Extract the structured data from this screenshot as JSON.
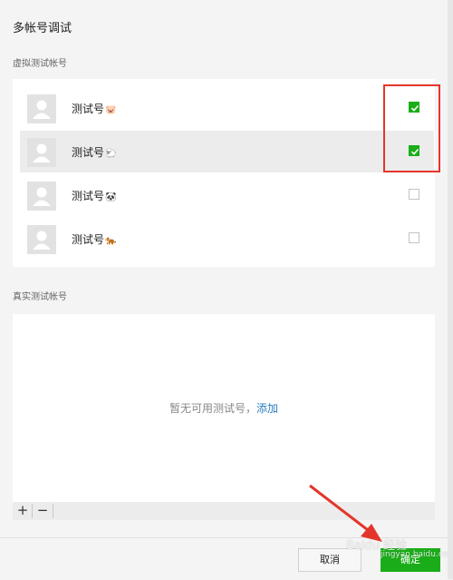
{
  "dialog": {
    "title": "多帐号调试"
  },
  "virtual_section": {
    "label": "虚拟测试帐号",
    "accounts": [
      {
        "name": "测试号",
        "emoji": "🐷",
        "checked": true
      },
      {
        "name": "测试号",
        "emoji": "🐑",
        "checked": true
      },
      {
        "name": "测试号",
        "emoji": "🐼",
        "checked": false
      },
      {
        "name": "测试号",
        "emoji": "🐅",
        "checked": false
      }
    ]
  },
  "real_section": {
    "label": "真实测试帐号",
    "empty_text": "暂无可用测试号，",
    "add_link": "添加"
  },
  "toolbar": {
    "add_label": "+",
    "remove_label": "−"
  },
  "footer": {
    "cancel_label": "取消",
    "ok_label": "确定"
  },
  "watermark": {
    "text": "Baidu 经验",
    "sub": "jingyan.baidu.com"
  },
  "colors": {
    "accent_green": "#1aad19",
    "annotation_red": "#e3362b",
    "link_blue": "#2e7ec0"
  }
}
